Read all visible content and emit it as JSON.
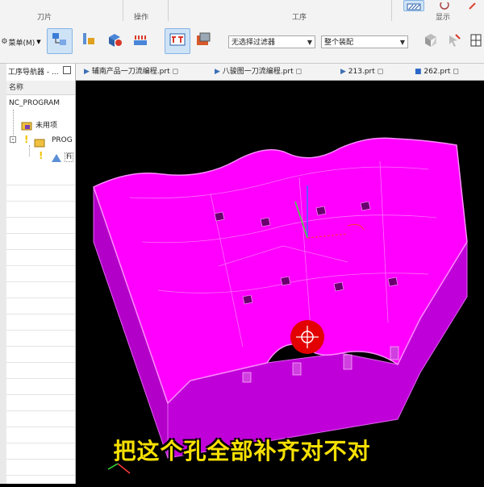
{
  "ribbon": {
    "groups": [
      "刀片",
      "操作",
      "工序",
      "显示"
    ],
    "menu_label": "菜单(M)",
    "filter_select": "无选择过滤器",
    "assembly_select": "整个装配"
  },
  "navigator": {
    "title": "工序导航器 - ...",
    "column_header": "名称",
    "items": [
      "NC_PROGRAM",
      "未用项",
      "PROG",
      "Fi"
    ]
  },
  "tabs": [
    "辅南产品一刀流编程.prt",
    "八骏图一刀流编程.prt",
    "213.prt",
    "262.prt"
  ],
  "subtitle": "把这个孔全部补齐对不对",
  "colors": {
    "model": "#ff00ff",
    "model_dark": "#b100c2",
    "subtitle": "#f6e000",
    "cursor": "#e30000"
  },
  "icons": [
    "menu-icon",
    "tool-icon",
    "geometry-icon",
    "method-icon",
    "create-operation-icon",
    "program-icon",
    "shaded-icon",
    "display-icon",
    "close-icon",
    "filter-icon",
    "select-icon"
  ]
}
